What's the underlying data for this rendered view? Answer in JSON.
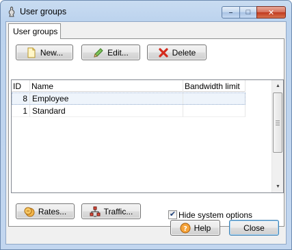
{
  "window": {
    "title": "User groups"
  },
  "titlebar": {
    "minimize_glyph": "–",
    "maximize_glyph": "□",
    "close_glyph": "✕"
  },
  "tab": {
    "label": "User groups"
  },
  "toolbar": {
    "new_label": "New...",
    "edit_label": "Edit...",
    "delete_label": "Delete"
  },
  "table": {
    "columns": [
      "ID",
      "Name",
      "Bandwidth limit"
    ],
    "rows": [
      {
        "id": "8",
        "name": "Employee",
        "bandwidth": ""
      },
      {
        "id": "1",
        "name": "Standard",
        "bandwidth": ""
      }
    ]
  },
  "scrollbar": {
    "up_glyph": "▲",
    "down_glyph": "▼"
  },
  "bottom": {
    "rates_label": "Rates...",
    "traffic_label": "Traffic...",
    "hide_system_label": "Hide system options",
    "hide_system_checked_glyph": "✔"
  },
  "footer": {
    "help_label": "Help",
    "close_label": "Close"
  },
  "icons": {
    "title": "user-groups-icon",
    "new": "new-document-icon",
    "edit": "pencil-icon",
    "delete": "red-x-icon",
    "rates": "coins-icon",
    "traffic": "network-icon",
    "help": "question-icon"
  },
  "colors": {
    "selected_row": "#eef4fb",
    "default_button_border": "#3c7fb1"
  }
}
